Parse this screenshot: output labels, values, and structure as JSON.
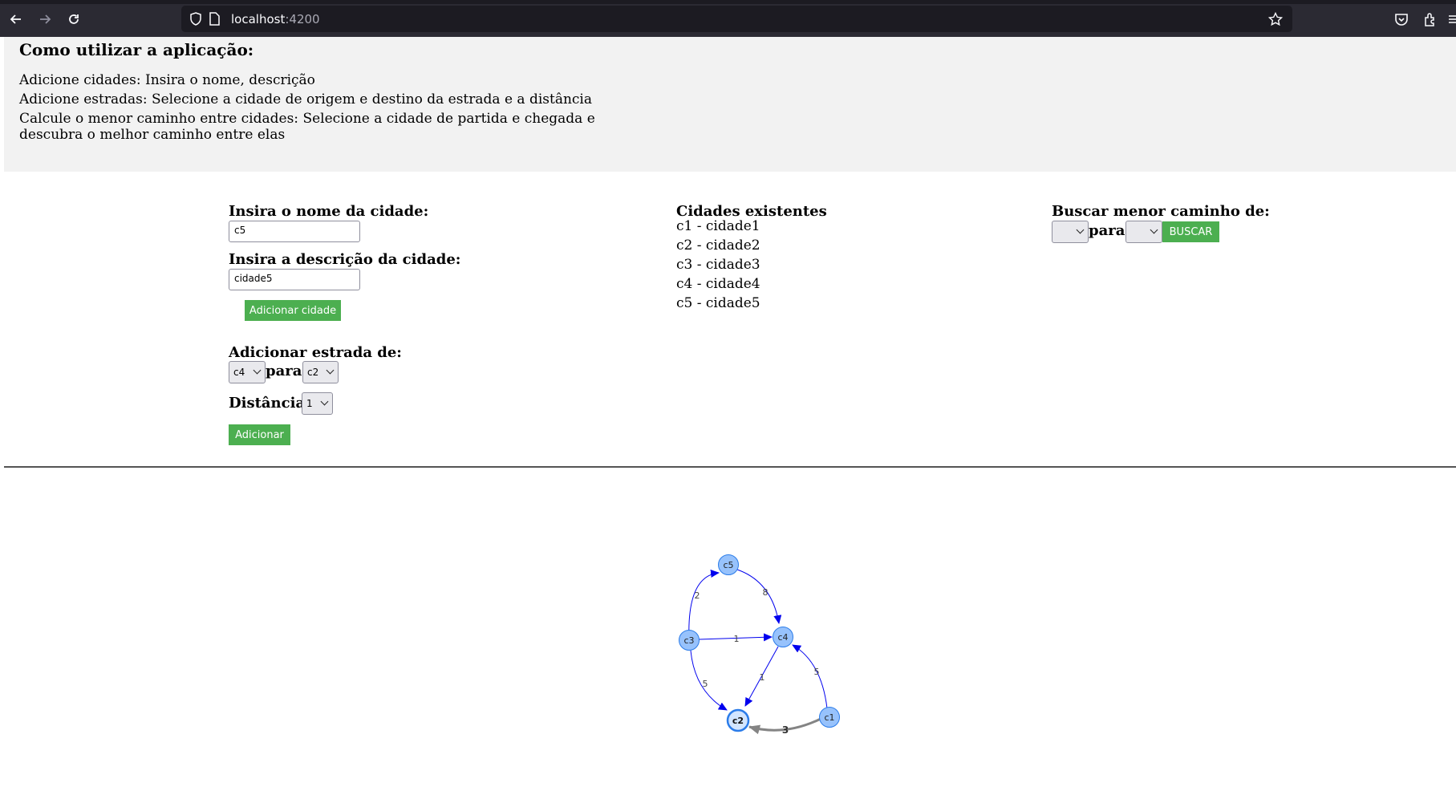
{
  "browser": {
    "url_host": "localhost",
    "url_port": ":4200"
  },
  "instructions": {
    "title": "Como utilizar a aplicação:",
    "lines": [
      "Adicione cidades: Insira o nome, descrição",
      "Adicione estradas: Selecione a cidade de origem e destino da estrada e a distância",
      "Calcule o menor caminho entre cidades: Selecione a cidade de partida e chegada e descubra o melhor caminho entre elas"
    ]
  },
  "add_city": {
    "name_label": "Insira o nome da cidade:",
    "name_value": "c5",
    "description_label": "Insira a descrição da cidade:",
    "description_value": "cidade5",
    "button": "Adicionar cidade"
  },
  "add_road": {
    "label": "Adicionar estrada de:",
    "from_value": "c4",
    "to_label": "para:",
    "to_value": "c2",
    "distance_label": "Distância:",
    "distance_value": "1",
    "button": "Adicionar"
  },
  "cities": {
    "title": "Cidades existentes",
    "items": [
      "c1 - cidade1",
      "c2 - cidade2",
      "c3 - cidade3",
      "c4 - cidade4",
      "c5 - cidade5"
    ]
  },
  "shortest_path": {
    "label": "Buscar menor caminho de:",
    "from_value": "",
    "to_label": "para:",
    "to_value": "",
    "button": "BUSCAR"
  },
  "graph": {
    "colors": {
      "node_fill": "#97c2fc",
      "node_stroke": "#2b7ce9",
      "edge": "#0000ee",
      "edge_highlight": "#848484"
    },
    "nodes": [
      "c1",
      "c2",
      "c3",
      "c4",
      "c5"
    ],
    "edges": [
      {
        "from": "c3",
        "to": "c5",
        "label": "2"
      },
      {
        "from": "c5",
        "to": "c4",
        "label": "8"
      },
      {
        "from": "c3",
        "to": "c4",
        "label": "1"
      },
      {
        "from": "c3",
        "to": "c2",
        "label": "5"
      },
      {
        "from": "c4",
        "to": "c2",
        "label": "1"
      },
      {
        "from": "c1",
        "to": "c4",
        "label": "5"
      },
      {
        "from": "c1",
        "to": "c2",
        "label": "3"
      }
    ]
  }
}
